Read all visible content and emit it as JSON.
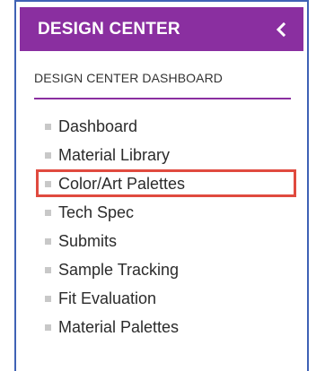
{
  "header": {
    "title": "DESIGN CENTER",
    "collapse_icon": "chevron-left-icon",
    "accent_color": "#8a2fa0"
  },
  "subheader": {
    "label": "DESIGN CENTER DASHBOARD"
  },
  "menu": {
    "items": [
      {
        "label": "Dashboard"
      },
      {
        "label": "Material Library"
      },
      {
        "label": "Color/Art Palettes",
        "highlighted": true
      },
      {
        "label": "Tech Spec"
      },
      {
        "label": "Submits"
      },
      {
        "label": "Sample Tracking"
      },
      {
        "label": "Fit Evaluation"
      },
      {
        "label": "Material Palettes"
      }
    ],
    "highlight_color": "#e04a3f"
  }
}
